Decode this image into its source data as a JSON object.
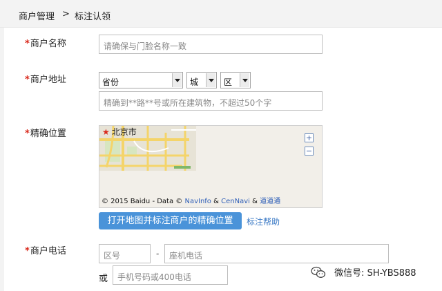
{
  "breadcrumb": {
    "section": "商户管理",
    "separator": ">",
    "current": "标注认领"
  },
  "form": {
    "required_mark": "*",
    "name": {
      "label": "商户名称",
      "placeholder": "请确保与门脸名称一致"
    },
    "address": {
      "label": "商户地址",
      "province": "省份",
      "city": "城",
      "district": "区",
      "detail_placeholder": "精确到**路**号或所在建筑物，不超过50个字"
    },
    "location": {
      "label": "精确位置",
      "map_city": "北京市",
      "zoom_in": "+",
      "zoom_out": "−",
      "copyright_prefix": "© 2015 Baidu - Data ©",
      "provider_1": "NavInfo",
      "amp_1": "&",
      "provider_2": "CenNavi",
      "amp_2": "&",
      "provider_3": "道道通",
      "open_map_button": "打开地图并标注商户的精确位置",
      "help_link": "标注帮助"
    },
    "phone": {
      "label": "商户电话",
      "area_code_placeholder": "区号",
      "dash": "-",
      "landline_placeholder": "座机电话",
      "or_text": "或",
      "mobile_placeholder": "手机号码或400电话"
    }
  },
  "watermark": {
    "text": "微信号: SH-YBS888"
  },
  "colors": {
    "required": "#d9291c",
    "button_bg": "#4a93d9",
    "link": "#3a79c5",
    "breadcrumb_bg": "#f3f3f3"
  }
}
